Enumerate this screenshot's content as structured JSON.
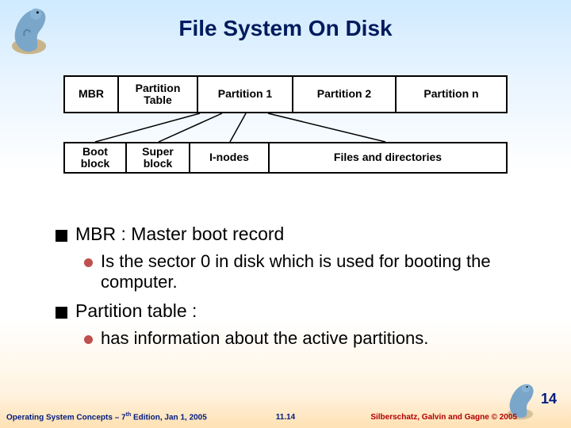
{
  "title": "File System  On Disk",
  "diagram": {
    "top": {
      "mbr": "MBR",
      "pt": "Partition\nTable",
      "p1": "Partition 1",
      "p2": "Partition 2",
      "pn": "Partition n"
    },
    "bottom": {
      "boot": "Boot block",
      "super": "Super block",
      "inodes": "I-nodes",
      "files": "Files and directories"
    }
  },
  "bullets": {
    "mbr_heading": "MBR : Master boot record",
    "mbr_sub": "Is  the sector 0 in disk which is used for booting the computer.",
    "pt_heading": " Partition table :",
    "pt_sub": "has information about the active partitions."
  },
  "footer": {
    "left_prefix": "Operating System Concepts – 7",
    "left_sup": "th",
    "left_suffix": " Edition, Jan 1, 2005",
    "center": "11.14",
    "right": "Silberschatz, Galvin and Gagne © 2005",
    "page_number": "14"
  }
}
